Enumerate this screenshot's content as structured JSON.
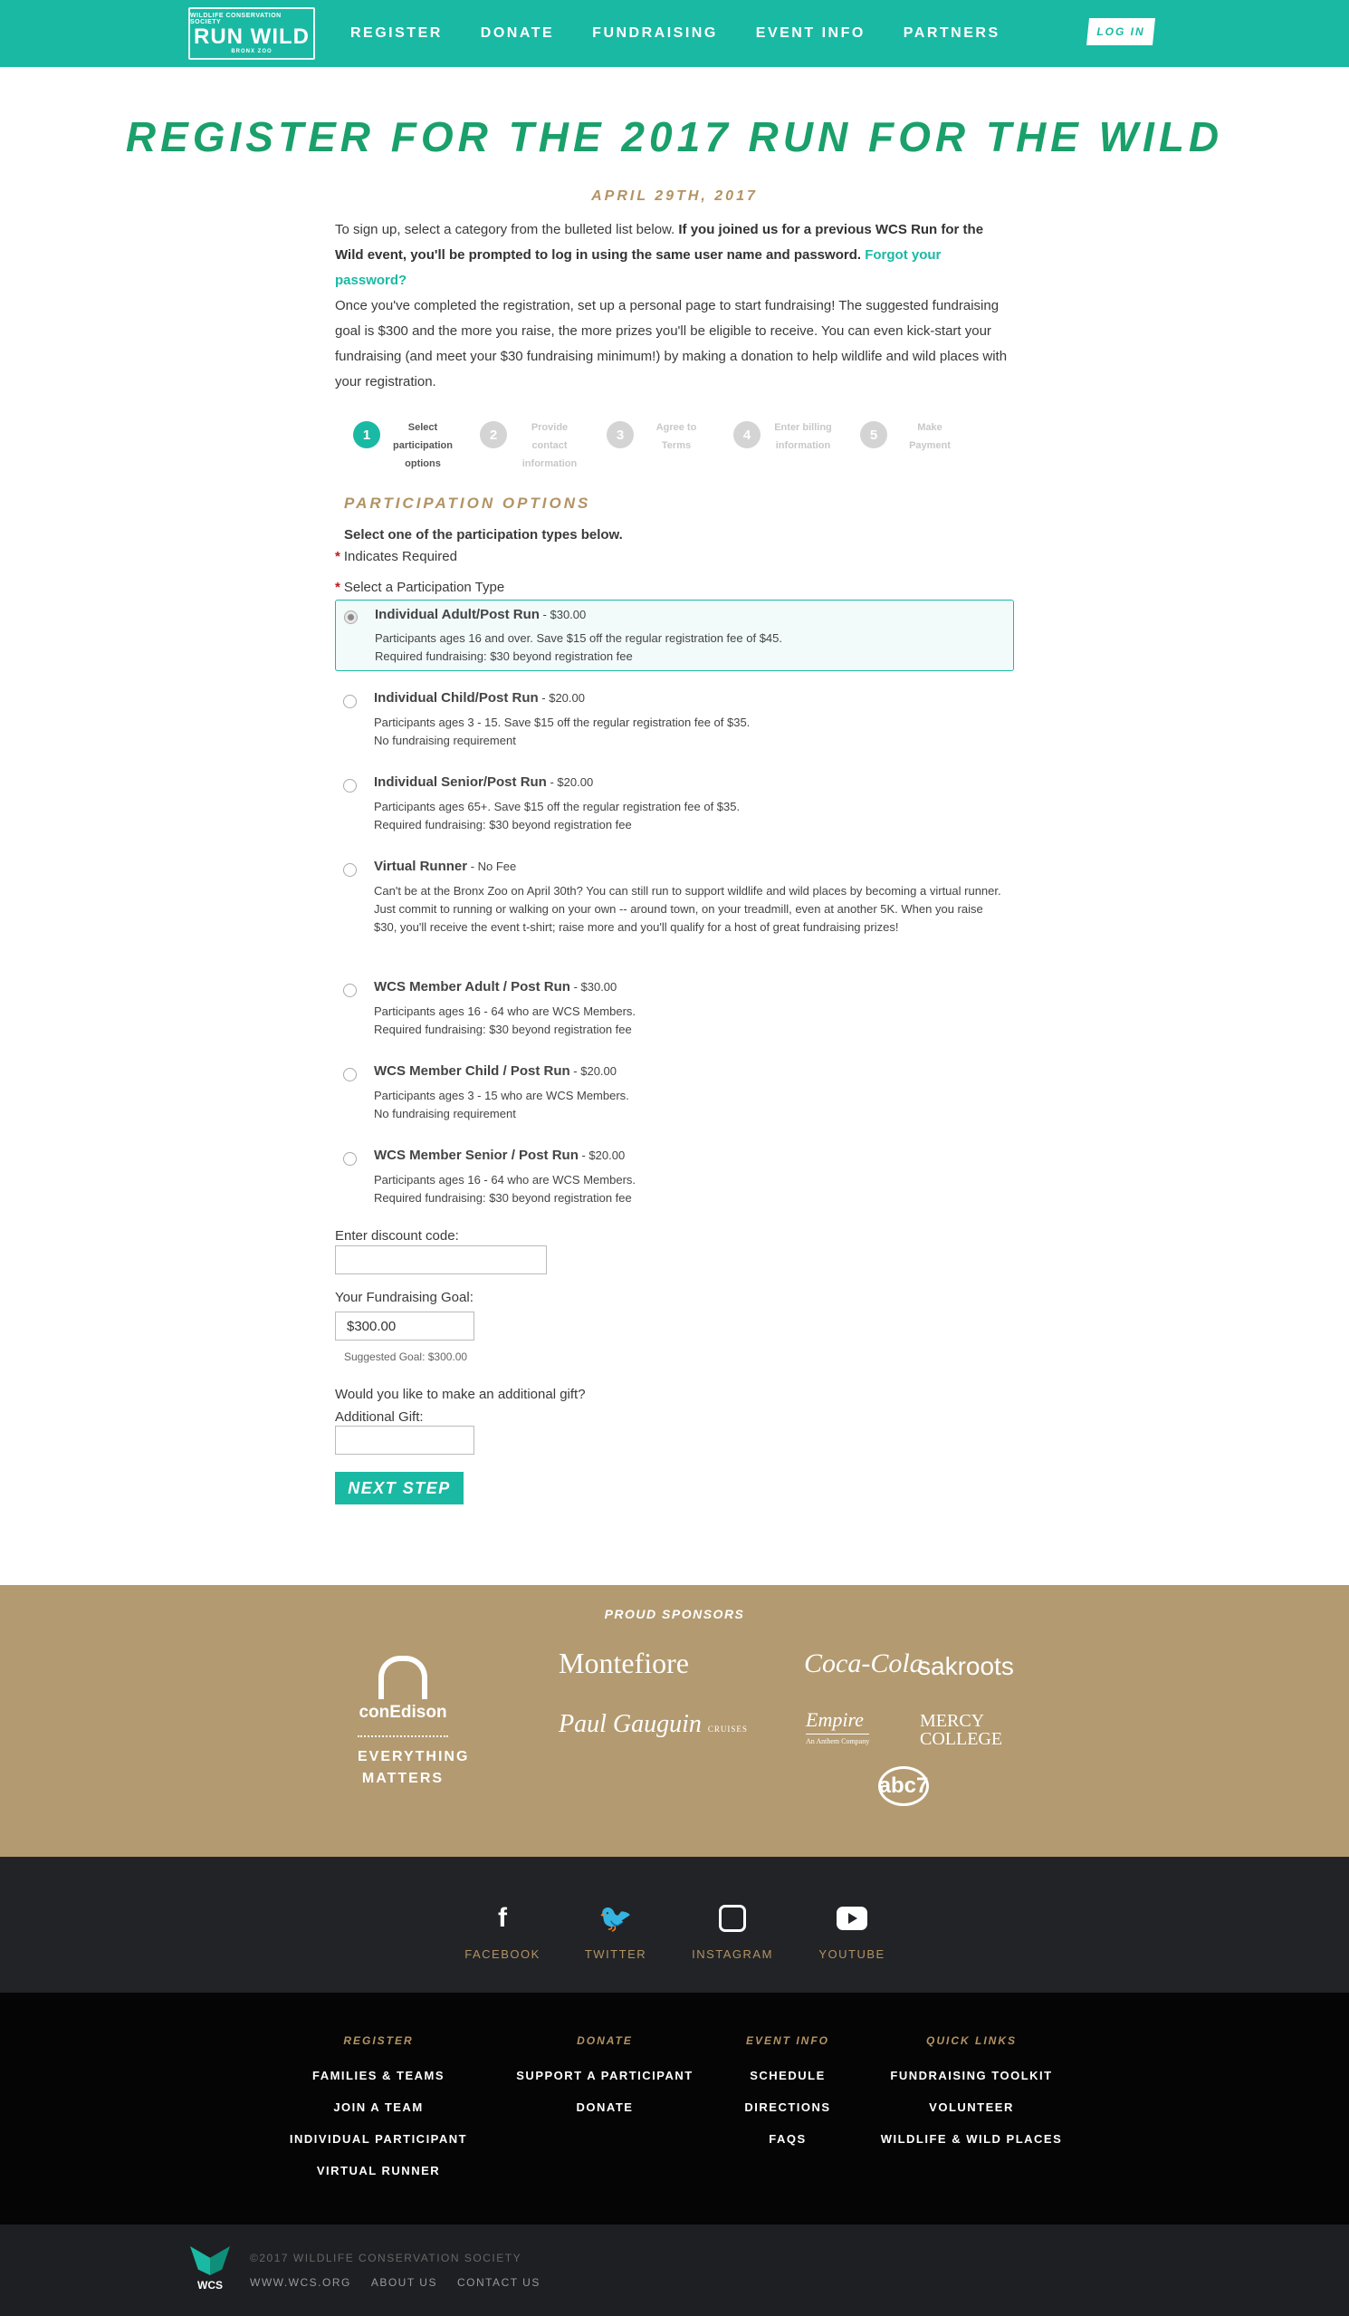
{
  "header": {
    "logo": {
      "line1": "WILDLIFE CONSERVATION SOCIETY",
      "line2": "RUN WILD",
      "line3": "BRONX ZOO"
    },
    "nav": [
      "REGISTER",
      "DONATE",
      "FUNDRAISING",
      "EVENT INFO",
      "PARTNERS"
    ],
    "login": "LOG IN"
  },
  "main": {
    "title": "REGISTER FOR THE 2017 RUN FOR THE WILD",
    "date": "APRIL 29TH, 2017",
    "intro1_plain": "To sign up, select a category from the bulleted list below. ",
    "intro1_bold": "If you joined us for a previous WCS Run for the Wild event, you'll be prompted to log in using the same user name and password. ",
    "forgot_link": "Forgot your password?",
    "intro2": "Once you've completed the registration, set up a personal page to start fundraising! The suggested fundraising goal is $300 and the more you raise, the more prizes you'll be eligible to receive. You can even kick-start your fundraising (and meet your $30 fundraising minimum!) by making a donation to help wildlife and wild places with your registration."
  },
  "steps": [
    {
      "num": "1",
      "label": "Select participation options"
    },
    {
      "num": "2",
      "label": "Provide contact information"
    },
    {
      "num": "3",
      "label": "Agree to Terms"
    },
    {
      "num": "4",
      "label": "Enter billing information"
    },
    {
      "num": "5",
      "label": "Make Payment"
    }
  ],
  "participation": {
    "heading": "PARTICIPATION OPTIONS",
    "subheading": "Select one of the participation types below.",
    "required_star": "*",
    "required_note": "Indicates Required",
    "type_label": "Select a Participation Type",
    "options": [
      {
        "title": "Individual Adult/Post Run",
        "price": " - $30.00",
        "desc1": "Participants ages 16 and over. Save $15 off the regular registration fee of $45.",
        "desc2": "Required fundraising: $30 beyond registration fee"
      },
      {
        "title": "Individual Child/Post Run",
        "price": " - $20.00",
        "desc1": "Participants ages 3 - 15. Save $15 off the regular registration fee of $35.",
        "desc2": "No fundraising requirement"
      },
      {
        "title": "Individual Senior/Post Run",
        "price": " - $20.00",
        "desc1": "Participants ages 65+. Save $15 off the regular registration fee of $35.",
        "desc2": "Required fundraising: $30 beyond registration fee"
      },
      {
        "title": "Virtual Runner",
        "price": " - No Fee",
        "desc1": "Can't be at the Bronx Zoo on April 30th? You can still run to support wildlife and wild places by becoming a virtual runner. Just commit to running or walking on your own -- around town, on your treadmill, even at another 5K. When you raise $30, you'll receive the event t-shirt; raise more and you'll qualify for a host of great fundraising prizes!",
        "desc2": ""
      },
      {
        "title": "WCS Member Adult / Post Run",
        "price": " - $30.00",
        "desc1": "Participants ages 16 - 64 who are WCS Members.",
        "desc2": "Required fundraising: $30 beyond registration fee"
      },
      {
        "title": "WCS Member Child / Post Run",
        "price": " - $20.00",
        "desc1": "Participants ages 3 - 15 who are WCS Members.",
        "desc2": "No fundraising requirement"
      },
      {
        "title": "WCS Member Senior / Post Run",
        "price": " - $20.00",
        "desc1": "Participants ages 16 - 64 who are WCS Members.",
        "desc2": "Required fundraising: $30 beyond registration fee"
      }
    ]
  },
  "form": {
    "discount_label": "Enter discount code:",
    "discount_value": "",
    "goal_label": "Your Fundraising Goal:",
    "goal_value": "$300.00",
    "suggested": "Suggested Goal: $300.00",
    "gift_question": "Would you like to make an additional gift?",
    "gift_label": "Additional Gift:",
    "gift_value": "",
    "next_button": "NEXT STEP"
  },
  "sponsors": {
    "title": "PROUD SPONSORS",
    "coned_name": "conEdison",
    "coned_tag1": "EVERYTHING",
    "coned_tag2": "MATTERS",
    "montefiore": "Montefiore",
    "gauguin": "Paul Gauguin",
    "gauguin_sub": "CRUISES",
    "cocacola": "Coca-Cola",
    "sakroots": "sakroots",
    "empire": "Empire",
    "empire_sub": "An Anthem Company",
    "mercy1": "MERCY",
    "mercy2": "COLLEGE",
    "abc": "abc7"
  },
  "social": [
    {
      "icon": "facebook-icon",
      "glyph": "f",
      "label": "FACEBOOK"
    },
    {
      "icon": "twitter-icon",
      "glyph": "🐦",
      "label": "TWITTER"
    },
    {
      "icon": "instagram-icon",
      "glyph": "",
      "label": "INSTAGRAM"
    },
    {
      "icon": "youtube-icon",
      "glyph": "",
      "label": "YOUTUBE"
    }
  ],
  "footer": {
    "register": {
      "heading": "REGISTER",
      "links": [
        "FAMILIES & TEAMS",
        "JOIN A TEAM",
        "INDIVIDUAL PARTICIPANT",
        "VIRTUAL RUNNER"
      ]
    },
    "donate": {
      "heading": "DONATE",
      "links": [
        "SUPPORT A PARTICIPANT",
        "DONATE"
      ]
    },
    "event": {
      "heading": "EVENT INFO",
      "links": [
        "SCHEDULE",
        "DIRECTIONS",
        "FAQS"
      ]
    },
    "quick": {
      "heading": "QUICK LINKS",
      "links": [
        "FUNDRAISING TOOLKIT",
        "VOLUNTEER",
        "WILDLIFE & WILD PLACES"
      ]
    }
  },
  "bottom": {
    "logo_text": "WCS",
    "copyright": "©2017 WILDLIFE CONSERVATION SOCIETY",
    "links": [
      "WWW.WCS.ORG",
      "ABOUT US",
      "CONTACT US"
    ]
  },
  "colors": {
    "teal": "#1ab9a4",
    "green_title": "#1aa06b",
    "gold": "#b39363",
    "required_red": "#c0161b"
  }
}
